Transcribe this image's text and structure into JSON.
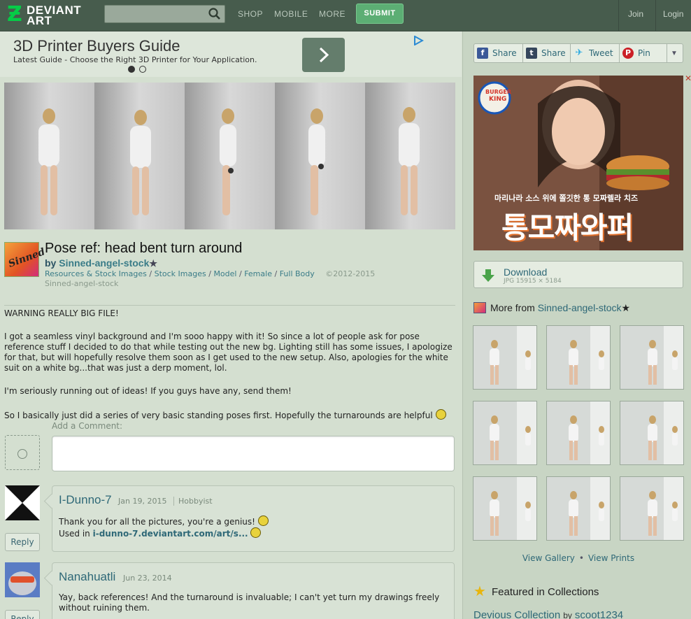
{
  "topbar": {
    "logo_line1": "DEVIANT",
    "logo_line2": "ART",
    "search_placeholder": "",
    "nav": [
      "SHOP",
      "MOBILE",
      "MORE"
    ],
    "submit": "SUBMIT",
    "join": "Join",
    "login": "Login",
    "accent": "#05cc47"
  },
  "ad_banner": {
    "title": "3D Printer Buyers Guide",
    "subtitle": "Latest Guide - Choose the Right 3D Printer for Your Application."
  },
  "deviation": {
    "title": "Pose ref: head bent turn around",
    "by": "by",
    "author": "Sinned-angel-stock",
    "author_symbol": "★",
    "avatar_text": "Sinned",
    "breadcrumb": [
      "Resources & Stock Images",
      "Stock Images",
      "Model",
      "Female",
      "Full Body"
    ],
    "copyright": "©2012-2015",
    "owner": "Sinned-angel-stock"
  },
  "description": {
    "paragraphs": [
      "WARNING REALLY BIG FILE!",
      "I got a seamless vinyl background and I'm sooo happy with it! So since a lot of people ask for pose reference stuff I decided to do that while testing out the new bg. Lighting still has some issues, I apologize for that, but will hopefully resolve them soon as I get used to the new setup. Also, apologies for the white suit on a white bg...that was just a derp moment, lol.",
      "I'm seriously running out of ideas! If you guys have any, send them!",
      "So I basically just did a series of very basic standing poses first. Hopefully the turnarounds are helpful"
    ]
  },
  "comment_form": {
    "label": "Add a Comment:"
  },
  "comments": [
    {
      "name": "I-Dunno-7",
      "date": "Jan 19, 2015",
      "role": "Hobbyist",
      "line1": "Thank you for all the pictures, you're a genius!",
      "used_in": "Used in",
      "link": "i-dunno-7.deviantart.com/art/s...",
      "reply": "Reply"
    },
    {
      "name": "Nanahuatli",
      "date": "Jun 23, 2014",
      "line1": "Yay, back references! And the turnaround is invaluable; I can't yet turn my drawings freely without ruining them.",
      "reply": "Reply"
    }
  ],
  "share": {
    "facebook": "Share",
    "tumblr": "Share",
    "twitter": "Tweet",
    "pinterest": "Pin"
  },
  "side_ad": {
    "brand_line1": "BURGER",
    "brand_line2": "KING",
    "korean_line": "마리나라 소스 위에 쫄깃한 통 모짜렐라 치즈",
    "korean_big": "통모짜와퍼",
    "close": "✕"
  },
  "download": {
    "label": "Download",
    "meta": "JPG 15915 × 5184"
  },
  "more_from": {
    "prefix": "More from",
    "author": "Sinned-angel-stock",
    "symbol": "★"
  },
  "gallery_links": {
    "view_gallery": "View Gallery",
    "bullet": "•",
    "view_prints": "View Prints"
  },
  "featured": {
    "title": "Featured in Collections",
    "collection": "Devious Collection",
    "by": "by",
    "collector": "scoot1234"
  }
}
